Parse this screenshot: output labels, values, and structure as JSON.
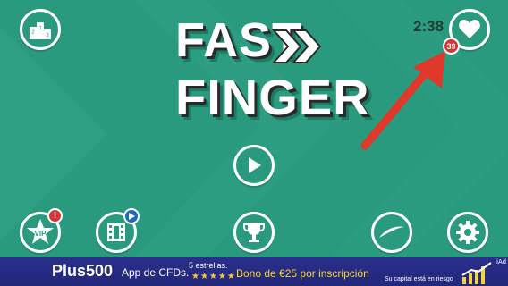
{
  "game": {
    "title_line1": "FAST",
    "title_line2": "FINGER",
    "timer": "2:38",
    "hearts_count": "39",
    "vip_label": "VIP",
    "vip_alert": "!"
  },
  "icons": {
    "leaderboard": "podium-icon",
    "favorite": "heart-icon",
    "vip": "vip-star-icon",
    "video": "film-video-icon",
    "play": "play-icon",
    "trophy": "trophy-icon",
    "swoosh": "swoosh-icon",
    "settings": "gear-icon",
    "pointer": "red-arrow-icon"
  },
  "ad": {
    "brand": "Plus500",
    "app_text": "App de CFDs.",
    "stars_label": "5 estrellas.",
    "stars": "★★★★★",
    "bonus_text": "Bono de €25 por inscripción",
    "risk_text": "Su capital está en riesgo",
    "ad_mark": "iAd"
  },
  "colors": {
    "background": "#2a9a7e",
    "accent_red": "#d93333",
    "ad_background": "#2a2f8c",
    "bonus_yellow": "#f3d43a"
  }
}
